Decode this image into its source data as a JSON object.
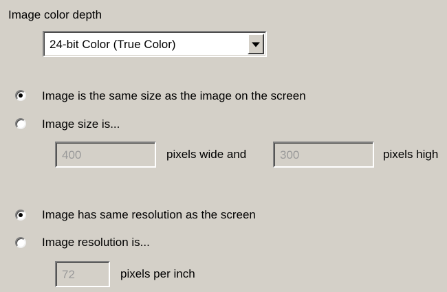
{
  "color_depth": {
    "label": "Image color depth",
    "selected": "24-bit Color (True Color)"
  },
  "size_options": {
    "same_size": {
      "label": "Image is the same size as the image on the screen",
      "checked": true
    },
    "custom_size": {
      "label": "Image size is...",
      "checked": false
    },
    "width_value": "400",
    "wide_and_label": "pixels wide and",
    "height_value": "300",
    "high_label": "pixels high"
  },
  "resolution_options": {
    "same_resolution": {
      "label": "Image has same resolution as the screen",
      "checked": true
    },
    "custom_resolution": {
      "label": "Image resolution is...",
      "checked": false
    },
    "ppi_value": "72",
    "ppi_label": "pixels per inch"
  }
}
